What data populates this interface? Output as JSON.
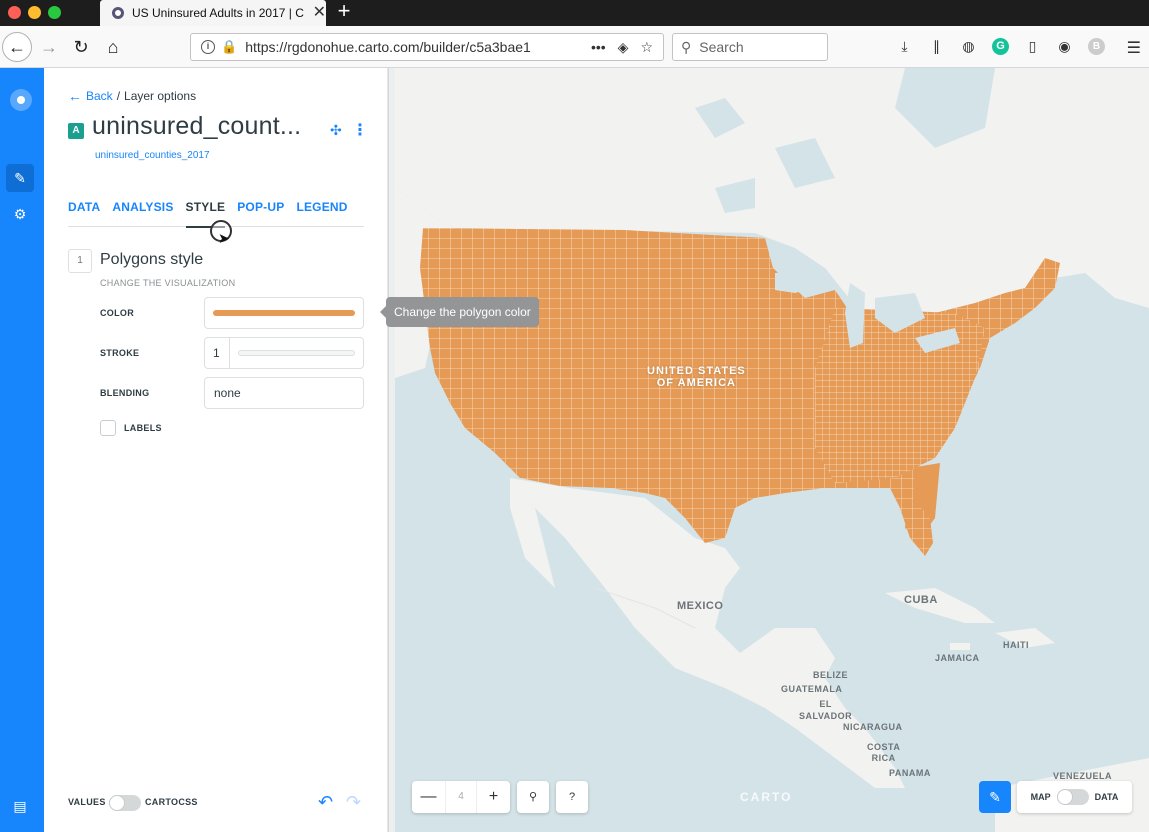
{
  "browser": {
    "tab_title": "US Uninsured Adults in 2017 | C",
    "tab_close": "✕",
    "new_tab": "+",
    "url": "https://rgdonohue.carto.com/builder/c5a3bae1",
    "url_actions": "•••",
    "search_placeholder": "Search"
  },
  "panel": {
    "back_label": "Back",
    "breadcrumb_separator": "/",
    "breadcrumb_current": "Layer options",
    "layer_letter": "A",
    "layer_title": "uninsured_count...",
    "layer_source": "uninsured_counties_2017",
    "tabs": [
      {
        "label": "DATA",
        "active": false
      },
      {
        "label": "ANALYSIS",
        "active": false
      },
      {
        "label": "STYLE",
        "active": true
      },
      {
        "label": "POP-UP",
        "active": false
      },
      {
        "label": "LEGEND",
        "active": false
      }
    ],
    "step_number": "1",
    "step_title": "Polygons style",
    "step_subtitle": "CHANGE THE VISUALIZATION",
    "fields": {
      "color_label": "COLOR",
      "color_value": "#e59a55",
      "stroke_label": "STROKE",
      "stroke_value": "1",
      "blending_label": "BLENDING",
      "blending_value": "none",
      "labels_label": "LABELS"
    },
    "tooltip": "Change the polygon color",
    "footer": {
      "values_label": "VALUES",
      "cartocss_label": "CARTOCSS"
    }
  },
  "map": {
    "labels": {
      "usa": "UNITED STATES\nOF AMERICA",
      "mexico": "MEXICO",
      "cuba": "CUBA",
      "jamaica": "JAMAICA",
      "haiti": "HAITI",
      "belize": "BELIZE",
      "guatemala": "GUATEMALA",
      "el_salvador": "EL\nSALVADOR",
      "nicaragua": "NICARAGUA",
      "costa_rica": "COSTA\nRICA",
      "panama": "PANAMA",
      "venezuela": "VENEZUELA"
    },
    "watermark": "CARTO",
    "zoom_level": "4",
    "map_toggle_label": "MAP",
    "data_toggle_label": "DATA"
  },
  "colors": {
    "brand": "#1785fb",
    "fill": "#e59a55"
  }
}
